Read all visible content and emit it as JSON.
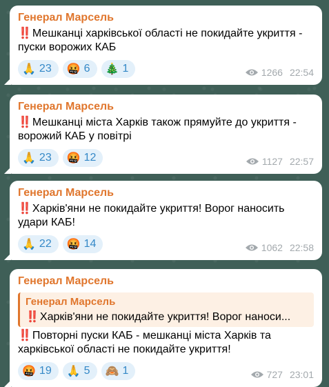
{
  "messages": [
    {
      "sender": "Генерал Марсель",
      "mark": "‼️",
      "text": "Мешканці харківської області не покидайте укриття - пуски ворожих КАБ",
      "reactions": [
        {
          "emoji": "🙏",
          "count": "23"
        },
        {
          "emoji": "🤬",
          "count": "6"
        },
        {
          "emoji": "🎄",
          "count": "1"
        }
      ],
      "views": "1266",
      "time": "22:54"
    },
    {
      "sender": "Генерал Марсель",
      "mark": "‼️",
      "text": "Мешканці міста Харків також прямуйте до укриття - ворожий КАБ у повітрі",
      "reactions": [
        {
          "emoji": "🙏",
          "count": "23"
        },
        {
          "emoji": "🤬",
          "count": "12"
        }
      ],
      "views": "1127",
      "time": "22:57"
    },
    {
      "sender": "Генерал Марсель",
      "mark": "‼️",
      "text": "Харків'яни не покидайте укриття! Ворог наносить удари КАБ!",
      "reactions": [
        {
          "emoji": "🙏",
          "count": "22"
        },
        {
          "emoji": "🤬",
          "count": "14"
        }
      ],
      "views": "1062",
      "time": "22:58"
    },
    {
      "sender": "Генерал Марсель",
      "reply": {
        "sender": "Генерал Марсель",
        "mark": "‼️",
        "text": "Харків'яни не покидайте укриття! Ворог наноси..."
      },
      "mark": "‼️",
      "text": "Повторні пуски КАБ - мешканці міста Харків та харківської області не покидайте укриття!",
      "reactions": [
        {
          "emoji": "🤬",
          "count": "19"
        },
        {
          "emoji": "🙏",
          "count": "5"
        },
        {
          "emoji": "🙈",
          "count": "1"
        }
      ],
      "views": "727",
      "time": "23:01"
    }
  ]
}
